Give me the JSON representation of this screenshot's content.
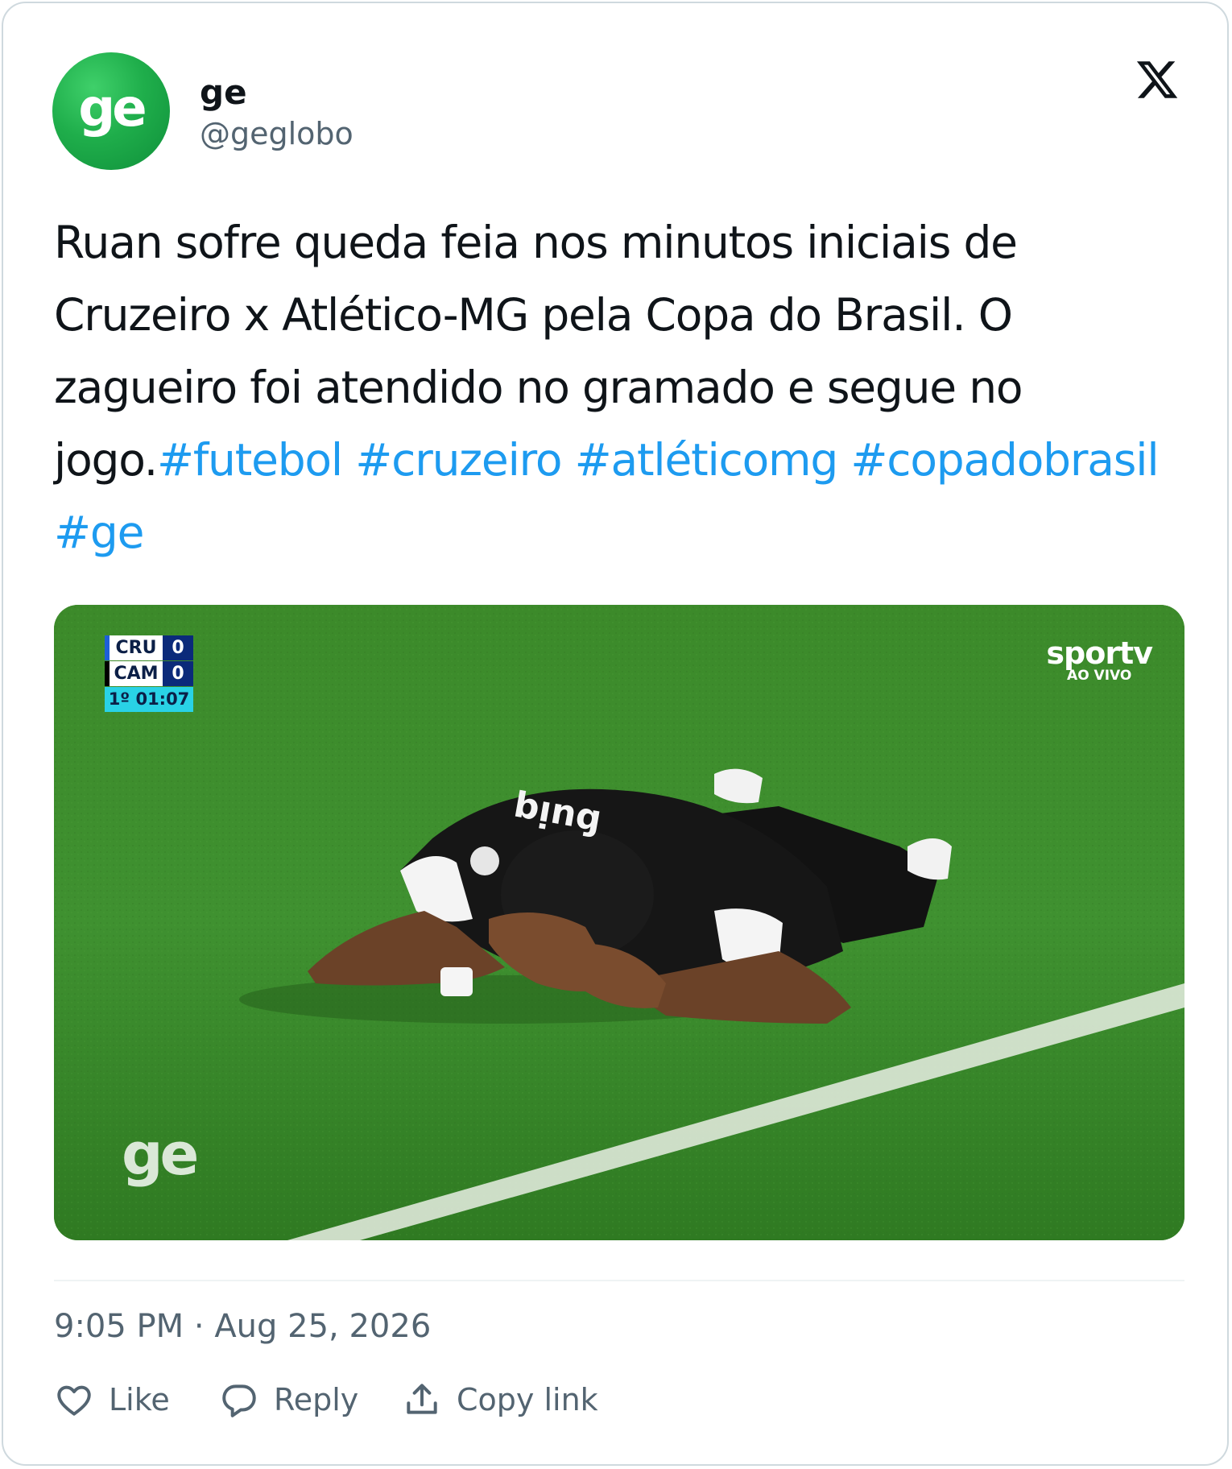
{
  "author": {
    "display_name": "ge",
    "handle": "@geglobo",
    "avatar_text": "ge"
  },
  "platform_icon": "x-logo-icon",
  "tweet": {
    "text_plain": "Ruan sofre queda feia nos minutos iniciais de Cruzeiro x Atlético-MG pela Copa do Brasil. O zagueiro foi atendido no gramado e segue no jogo.",
    "hashtags": [
      "#futebol",
      "#cruzeiro",
      "#atléticomg",
      "#copadobrasil",
      "#ge"
    ]
  },
  "media": {
    "scoreboard": {
      "teams": [
        {
          "name": "CRU",
          "score": "0"
        },
        {
          "name": "CAM",
          "score": "0"
        }
      ],
      "clock": "1º 01:07"
    },
    "broadcaster": {
      "brand": "sportv",
      "status": "AO VIVO"
    },
    "watermark": "ge",
    "colors": {
      "pitch": "#3f8a2b",
      "scoreboard_time_bg": "#29d2e6"
    }
  },
  "timestamp": "9:05 PM · Aug 25, 2026",
  "actions": {
    "like": {
      "label": "Like",
      "icon": "heart-icon"
    },
    "reply": {
      "label": "Reply",
      "icon": "speech-bubble-icon"
    },
    "copy": {
      "label": "Copy link",
      "icon": "upload-arrow-icon"
    }
  },
  "colors": {
    "hashtag": "#1d9bf0",
    "secondary_text": "#536471",
    "border": "#cfd9de"
  }
}
